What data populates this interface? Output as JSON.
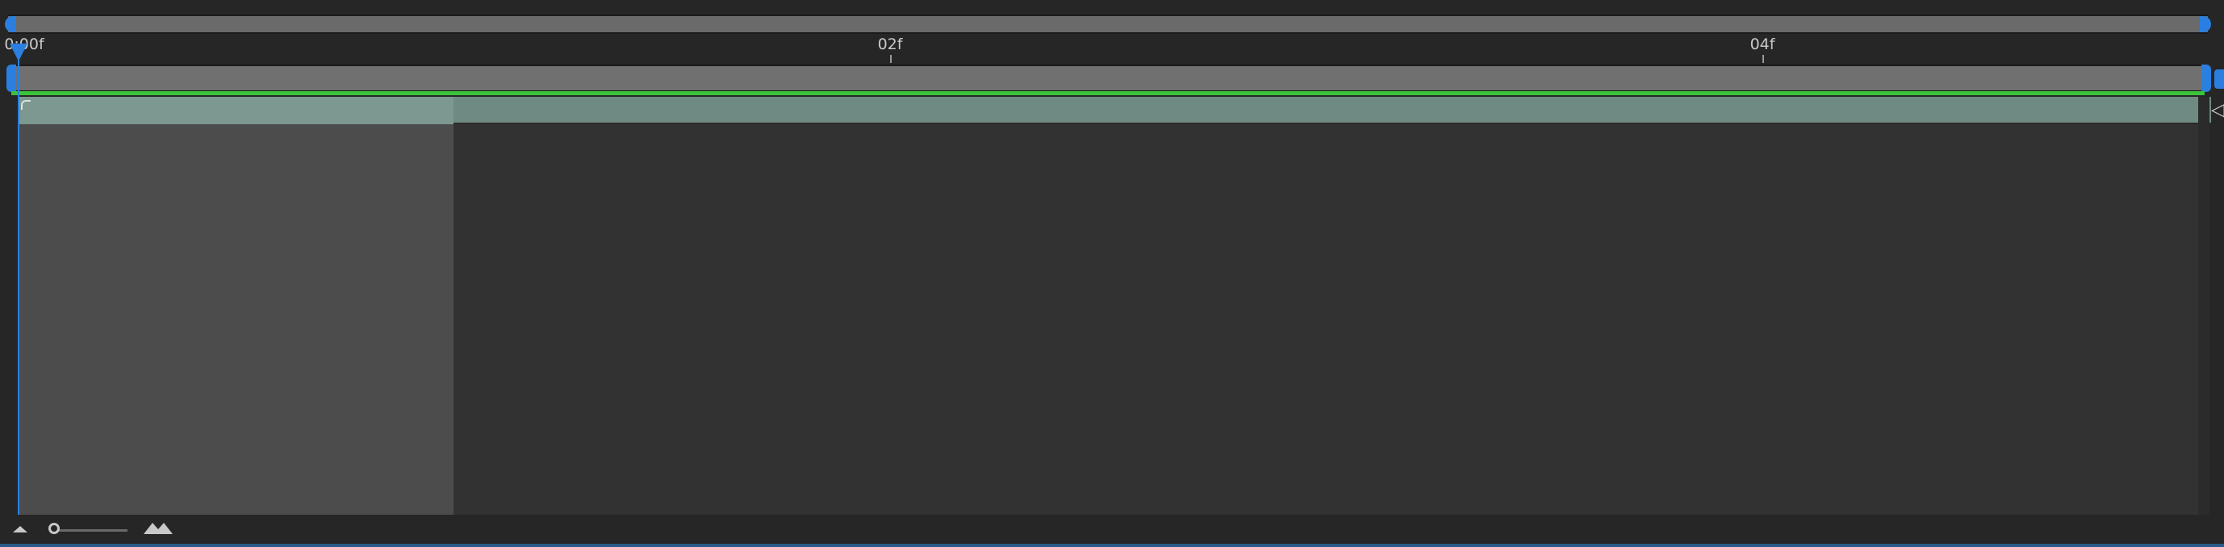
{
  "timeline": {
    "ruler": {
      "ticks": [
        {
          "label": "0:00f"
        },
        {
          "label": "02f"
        },
        {
          "label": "04f"
        }
      ]
    },
    "playhead": {
      "frame": "0:00f"
    }
  },
  "icons": {
    "zoom_out": "zoom-out-mountain-icon",
    "zoom_in": "zoom-in-mountain-icon",
    "layer_end": "layer-out-point-icon",
    "in_point": "layer-in-point-icon"
  },
  "colors": {
    "accent": "#2a7fe0",
    "cache": "#3bc23b",
    "layer_bar": "#6f8a83",
    "background": "#262626"
  }
}
